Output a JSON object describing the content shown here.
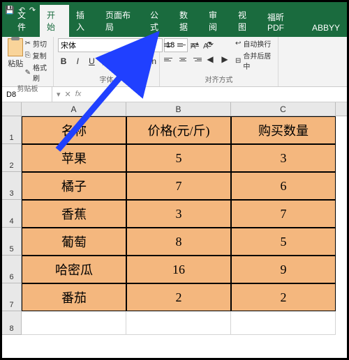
{
  "titlebar": {
    "save_icon": "💾",
    "undo_icon": "↶",
    "redo_icon": "↷"
  },
  "tabs": {
    "file": "文件",
    "home": "开始",
    "insert": "插入",
    "layout": "页面布局",
    "formula": "公式",
    "data": "数据",
    "review": "审阅",
    "view": "视图",
    "foxit": "福昕PDF",
    "abbyy": "ABBYY"
  },
  "ribbon": {
    "paste": "粘贴",
    "cut": "剪切",
    "copy": "复制",
    "format_painter": "格式刷",
    "clipboard_label": "剪贴板",
    "font_name": "宋体",
    "font_size": "18",
    "font_label": "字体",
    "wrap_text": "自动换行",
    "merge_center": "合并后居中",
    "align_label": "对齐方式"
  },
  "namebox": {
    "value": "D8"
  },
  "fx": {
    "fx": "fx",
    "drop": "▾",
    "x": "✕"
  },
  "columns": [
    "A",
    "B",
    "C"
  ],
  "rows": [
    "1",
    "2",
    "3",
    "4",
    "5",
    "6",
    "7",
    "8"
  ],
  "table": {
    "headers": [
      "名称",
      "价格(元/斤)",
      "购买数量"
    ],
    "data": [
      [
        "苹果",
        "5",
        "3"
      ],
      [
        "橘子",
        "7",
        "6"
      ],
      [
        "香蕉",
        "3",
        "7"
      ],
      [
        "葡萄",
        "8",
        "5"
      ],
      [
        "哈密瓜",
        "16",
        "9"
      ],
      [
        "番茄",
        "2",
        "2"
      ]
    ]
  },
  "chart_data": {
    "type": "table",
    "title": "",
    "columns": [
      "名称",
      "价格(元/斤)",
      "购买数量"
    ],
    "rows": [
      {
        "名称": "苹果",
        "价格(元/斤)": 5,
        "购买数量": 3
      },
      {
        "名称": "橘子",
        "价格(元/斤)": 7,
        "购买数量": 6
      },
      {
        "名称": "香蕉",
        "价格(元/斤)": 3,
        "购买数量": 7
      },
      {
        "名称": "葡萄",
        "价格(元/斤)": 8,
        "购买数量": 5
      },
      {
        "名称": "哈密瓜",
        "价格(元/斤)": 16,
        "购买数量": 9
      },
      {
        "名称": "番茄",
        "价格(元/斤)": 2,
        "购买数量": 2
      }
    ]
  }
}
